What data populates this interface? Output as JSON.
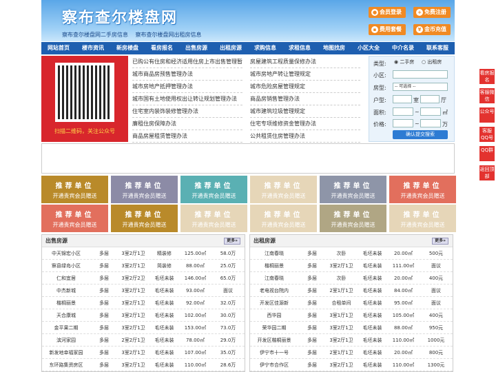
{
  "site": {
    "logo": "察布查尔楼盘网",
    "sublinks": [
      "察布查尔楼盘网二手房信息",
      "察布查尔楼盘网出租房信息"
    ]
  },
  "header_buttons": [
    {
      "label": "会员登录",
      "icon": "user-icon"
    },
    {
      "label": "免费注册",
      "icon": "register-icon"
    },
    {
      "label": "费用套餐",
      "icon": "package-icon"
    },
    {
      "label": "金币充值",
      "icon": "coin-icon"
    }
  ],
  "nav": [
    "网站首页",
    "楼市资讯",
    "新房楼盘",
    "看房报名",
    "出售房源",
    "出租房源",
    "求购信息",
    "求租信息",
    "地图找房",
    "小区大全",
    "中介名录",
    "联系客服"
  ],
  "qr": {
    "caption": "扫描二维码，关注公众号"
  },
  "links": [
    [
      "已购公有住房和经济适用住房上市出售管理暂",
      "房屋建筑工程质量保修办法"
    ],
    [
      "城市商品房预售管理办法",
      "城市房地产转让管理规定"
    ],
    [
      "城市房地产抵押管理办法",
      "城市危险房屋管理规定"
    ],
    [
      "城市国有土地使用权出让转让规划管理办法",
      "商品房销售管理办法"
    ],
    [
      "住宅室内装饰装修管理办法",
      "城市建筑垃圾管理规定"
    ],
    [
      "廉租住房保障办法",
      "住宅专项维修资金管理办法"
    ],
    [
      "商品房屋租赁管理办法",
      "公共租赁住房管理办法"
    ]
  ],
  "search": {
    "type_label": "类型:",
    "type_options": [
      "二手房",
      "出租房"
    ],
    "community_label": "小区:",
    "housetype_label": "房型:",
    "housetype_select": "-- 可选择 --",
    "layout_label": "户型:",
    "room_unit": "室",
    "hall_unit": "厅",
    "area_label": "面积:",
    "area_sep": "~",
    "area_unit": "㎡",
    "price_label": "价格:",
    "price_sep": "~",
    "price_unit": "万",
    "submit": "确认提交搜索"
  },
  "tiles": {
    "line1": "推荐单位",
    "line2": "开通贵宾会员赠送",
    "colors": [
      "#b98a2a",
      "#8c8ba6",
      "#5ab0b3",
      "#e6d6b8",
      "#8e95a8",
      "#e26f5d",
      "#e26f5d",
      "#b98a2a",
      "#e6d6b8",
      "#e6d6b8",
      "#b0a684",
      "#e6d6b8"
    ]
  },
  "sale": {
    "title": "出售房源",
    "more": "更多»",
    "rows": [
      [
        "中天锦宏小区",
        "多层",
        "3室2厅1卫",
        "精装修",
        "125.00㎡",
        "58.0万"
      ],
      [
        "察县绿岛小区",
        "多层",
        "3室2厅1卫",
        "简装修",
        "88.00㎡",
        "25.0万"
      ],
      [
        "仁和宜居",
        "多层",
        "3室2厅2卫",
        "毛坯未装",
        "146.00㎡",
        "65.0万"
      ],
      [
        "中杰新城",
        "多层",
        "3室2厅1卫",
        "毛坯未装",
        "93.00㎡",
        "面议"
      ],
      [
        "楷桐丽景",
        "多层",
        "3室2厅1卫",
        "毛坯未装",
        "92.00㎡",
        "32.0万"
      ],
      [
        "天合康城",
        "多层",
        "3室2厅1卫",
        "毛坯未装",
        "102.00㎡",
        "30.0万"
      ],
      [
        "金平果二期",
        "多层",
        "3室2厅1卫",
        "毛坯未装",
        "153.00㎡",
        "73.0万"
      ],
      [
        "滨河家园",
        "多层",
        "2室2厅1卫",
        "毛坯未装",
        "78.00㎡",
        "29.0万"
      ],
      [
        "新发地幸福家园",
        "多层",
        "3室2厅1卫",
        "毛坯未装",
        "107.00㎡",
        "35.0万"
      ],
      [
        "东环路集资房区",
        "多层",
        "3室2厅1卫",
        "毛坯未装",
        "110.00㎡",
        "28.6万"
      ]
    ]
  },
  "rent": {
    "title": "出租房源",
    "more": "更多»",
    "rows": [
      [
        "江南春晓",
        "多层",
        "次卧",
        "毛坯未装",
        "20.00㎡",
        "500元"
      ],
      [
        "楷桐丽景",
        "多层",
        "3室2厅1卫",
        "毛坯未装",
        "111.00㎡",
        "面议"
      ],
      [
        "江南春晓",
        "多层",
        "次卧",
        "毛坯未装",
        "20.00㎡",
        "400元"
      ],
      [
        "老电视台院内",
        "多层",
        "2室1厅1卫",
        "毛坯未装",
        "84.00㎡",
        "面议"
      ],
      [
        "开发区佳源新",
        "多层",
        "合租单间",
        "毛坯未装",
        "95.00㎡",
        "面议"
      ],
      [
        "西华园",
        "多层",
        "3室1厅1卫",
        "毛坯未装",
        "105.00㎡",
        "400元"
      ],
      [
        "荣华园二期",
        "多层",
        "3室2厅1卫",
        "毛坯未装",
        "88.00㎡",
        "950元"
      ],
      [
        "开发区楷桐丽景",
        "多层",
        "3室2厅1卫",
        "毛坯未装",
        "110.00㎡",
        "1000元"
      ],
      [
        "伊宁市十一号",
        "多层",
        "2室1厅1卫",
        "毛坯未装",
        "20.00㎡",
        "800元"
      ],
      [
        "伊宁市合作区",
        "多层",
        "3室2厅1卫",
        "毛坯未装",
        "110.00㎡",
        "1300元"
      ]
    ]
  },
  "sidebar": [
    "看房报名",
    "客服微信",
    "公众号",
    "客服QQ号",
    "QQ群",
    "返回顶部"
  ]
}
